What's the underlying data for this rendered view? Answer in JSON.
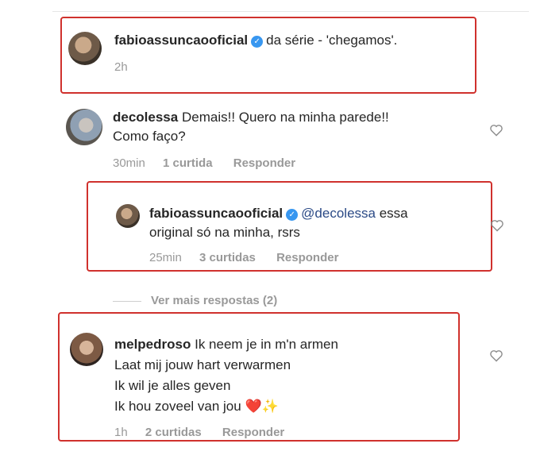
{
  "colors": {
    "highlight": "#d0312d",
    "verified": "#3897f0",
    "mention": "#2b4a86",
    "meta": "#999999"
  },
  "comments": [
    {
      "username": "fabioassuncaooficial",
      "verified": true,
      "text_lines": [
        "da série - 'chegamos'."
      ],
      "time": "2h"
    },
    {
      "username": "decolessa",
      "verified": false,
      "text_lines": [
        "Demais!! Quero na minha parede!!",
        "Como faço?"
      ],
      "time": "30min",
      "likes": "1 curtida",
      "reply_label": "Responder"
    },
    {
      "username": "fabioassuncaooficial",
      "verified": true,
      "mention": "@decolessa",
      "text_lines": [
        "essa",
        "original só na minha, rsrs"
      ],
      "time": "25min",
      "likes": "3 curtidas",
      "reply_label": "Responder"
    },
    {
      "username": "melpedroso",
      "verified": false,
      "text_lines": [
        "Ik neem je in m'n armen",
        "Laat mij jouw hart verwarmen",
        "Ik wil je alles geven",
        "Ik hou zoveel van jou"
      ],
      "emojis": "❤️✨",
      "time": "1h",
      "likes": "2 curtidas",
      "reply_label": "Responder"
    }
  ],
  "more_replies": "Ver mais respostas (2)",
  "icons": {
    "verified": "verified-badge-icon",
    "like": "heart-outline-icon"
  }
}
